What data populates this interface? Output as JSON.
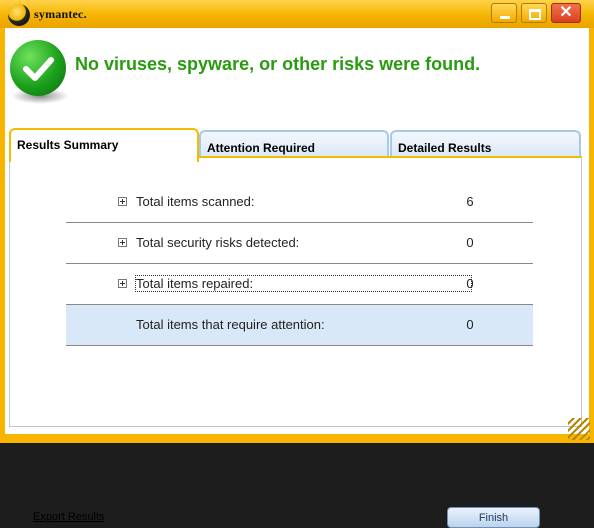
{
  "window": {
    "brand": "symantec.",
    "controls": {
      "minimize": "minimize",
      "maximize": "maximize",
      "close": "close"
    }
  },
  "header": {
    "message": "No viruses, spyware, or other risks were found.",
    "status_icon": "checkmark-icon",
    "status_color": "#2a9a10"
  },
  "tabs": [
    {
      "label": "Results Summary",
      "active": true
    },
    {
      "label": "Attention Required",
      "active": false
    },
    {
      "label": "Detailed Results",
      "active": false
    }
  ],
  "summary": {
    "rows": [
      {
        "label": "Total items scanned:",
        "value": "6",
        "expandable": true
      },
      {
        "label": "Total security risks detected:",
        "value": "0",
        "expandable": true
      },
      {
        "label": "Total items repaired:",
        "value": "0",
        "expandable": true
      },
      {
        "label": "Total items that require attention:",
        "value": "0",
        "expandable": false,
        "highlighted": true
      }
    ]
  },
  "footer": {
    "export_label": "Export Results",
    "finish_label": "Finish"
  },
  "colors": {
    "frame": "#f7b500",
    "accent_blue": "#a6c8ea",
    "highlight_row": "#d9e8f8"
  }
}
